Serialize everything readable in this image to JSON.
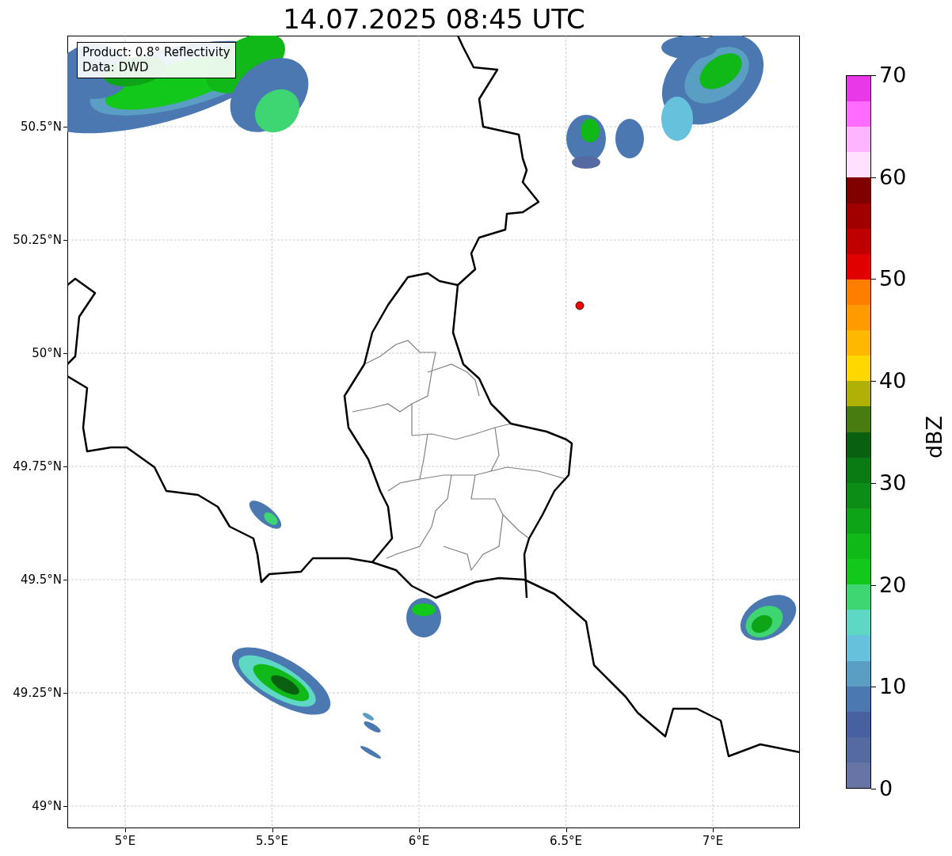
{
  "title": "14.07.2025 08:45 UTC",
  "info_box": {
    "lines": [
      "Product: 0.8° Reflectivity",
      "Data: DWD"
    ]
  },
  "map": {
    "y_ticks": [
      "50.5°N",
      "50.25°N",
      "50°N",
      "49.75°N",
      "49.5°N",
      "49.25°N",
      "49°N"
    ],
    "x_ticks": [
      "5°E",
      "5.5°E",
      "6°E",
      "6.5°E",
      "7°E"
    ]
  },
  "colorbar": {
    "label": "dBZ",
    "ticks": [
      "70",
      "60",
      "50",
      "40",
      "30",
      "20",
      "10",
      "0"
    ],
    "bands": [
      {
        "color": "#e838e8"
      },
      {
        "color": "#ff6cff"
      },
      {
        "color": "#ffb4ff"
      },
      {
        "color": "#ffe0ff"
      },
      {
        "color": "#800000"
      },
      {
        "color": "#a00000"
      },
      {
        "color": "#c00000"
      },
      {
        "color": "#e00000"
      },
      {
        "color": "#ff7e00"
      },
      {
        "color": "#ff9a00"
      },
      {
        "color": "#ffb800"
      },
      {
        "color": "#ffd800"
      },
      {
        "color": "#b0b006"
      },
      {
        "color": "#487c10"
      },
      {
        "color": "#086010"
      },
      {
        "color": "#0a7a12"
      },
      {
        "color": "#0c8e16"
      },
      {
        "color": "#0ea418"
      },
      {
        "color": "#10b818"
      },
      {
        "color": "#12c81a"
      },
      {
        "color": "#3dd672"
      },
      {
        "color": "#5ed8c4"
      },
      {
        "color": "#66c2dc"
      },
      {
        "color": "#5b9ec4"
      },
      {
        "color": "#4b78b0"
      },
      {
        "color": "#4760a0"
      },
      {
        "color": "#566aa2"
      },
      {
        "color": "#6674a6"
      }
    ]
  }
}
